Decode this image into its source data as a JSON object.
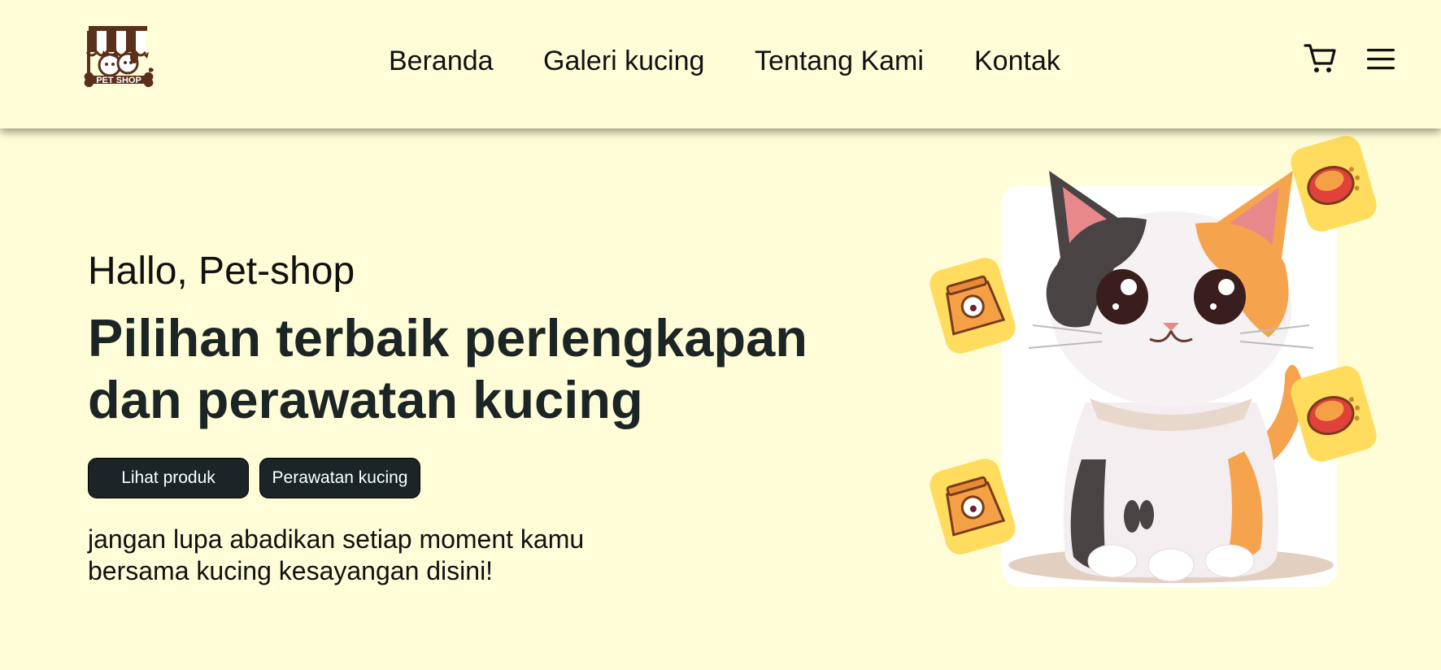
{
  "header": {
    "logo_text": "PET SHOP",
    "nav": [
      {
        "label": "Beranda"
      },
      {
        "label": "Galeri kucing"
      },
      {
        "label": "Tentang Kami"
      },
      {
        "label": "Kontak"
      }
    ],
    "icons": [
      "cart-icon",
      "menu-icon"
    ]
  },
  "hero": {
    "greeting": "Hallo, Pet-shop",
    "title": "Pilihan terbaik perlengkapan dan perawatan kucing",
    "buttons": [
      {
        "label": "Lihat produk"
      },
      {
        "label": "Perawatan kucing"
      }
    ],
    "description": "jangan lupa abadikan setiap moment kamu bersama kucing kesayangan disini!"
  },
  "illustration": {
    "icons": [
      "calico-cat-icon",
      "cat-food-bag-icon",
      "food-bowl-icon"
    ]
  },
  "colors": {
    "background": "#fffdd7",
    "button_bg": "#1b2426",
    "text_dark": "#1c2526",
    "logo_brown": "#5a2f1c",
    "tile_yellow": "#ffdc5e"
  }
}
